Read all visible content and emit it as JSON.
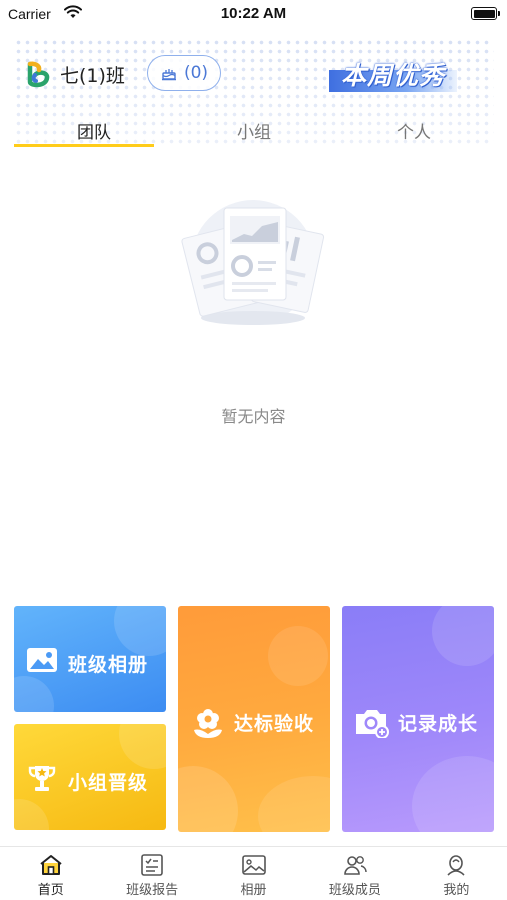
{
  "status_bar": {
    "carrier": "Carrier",
    "time": "10:22 AM"
  },
  "header": {
    "class_name": "七(1)班",
    "cake_count": "(0)",
    "weekly_best": "本周优秀",
    "tabs": [
      {
        "label": "团队",
        "active": true
      },
      {
        "label": "小组",
        "active": false
      },
      {
        "label": "个人",
        "active": false
      }
    ]
  },
  "empty_state": {
    "message": "暂无内容"
  },
  "feature_cards": {
    "album": "班级相册",
    "group_promotion": "小组晋级",
    "standard_check": "达标验收",
    "record_growth": "记录成长"
  },
  "bottom_nav": {
    "items": [
      {
        "label": "首页",
        "icon": "home-icon",
        "active": true
      },
      {
        "label": "班级报告",
        "icon": "report-icon",
        "active": false
      },
      {
        "label": "相册",
        "icon": "album-icon",
        "active": false
      },
      {
        "label": "班级成员",
        "icon": "members-icon",
        "active": false
      },
      {
        "label": "我的",
        "icon": "profile-icon",
        "active": false
      }
    ]
  },
  "colors": {
    "accent_yellow": "#ffcc1a",
    "album_blue": "#3c8cf2",
    "group_yellow": "#f6b912",
    "standard_orange": "#ff9b3a",
    "growth_purple": "#9f88fa"
  }
}
